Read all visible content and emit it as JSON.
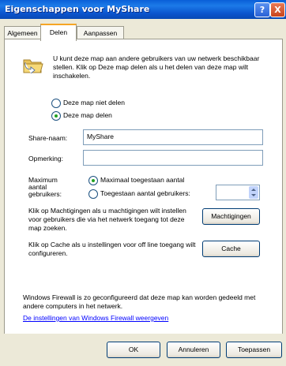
{
  "window": {
    "title": "Eigenschappen voor MyShare",
    "help_glyph": "?",
    "close_glyph": "X"
  },
  "tabs": [
    {
      "label": "Algemeen"
    },
    {
      "label": "Delen"
    },
    {
      "label": "Aanpassen"
    }
  ],
  "intro_text": "U kunt deze map aan andere gebruikers van uw netwerk beschikbaar stellen. Klik op Deze map delen als u het delen van deze map wilt inschakelen.",
  "share_options": {
    "not_share": "Deze map niet delen",
    "share": "Deze map delen"
  },
  "form": {
    "share_name_label": "Share-naam:",
    "share_name_value": "MyShare",
    "comment_label": "Opmerking:",
    "comment_value": "",
    "max_users_label_1": "Maximum",
    "max_users_label_2": "aantal",
    "max_users_label_3": "gebruikers:",
    "max_allowed": "Maximaal toegestaan aantal",
    "allowed_users": "Toegestaan aantal gebruikers:",
    "allowed_users_value": ""
  },
  "permissions": {
    "text": "Klik op Machtigingen als u machtigingen wilt instellen voor gebruikers die via het netwerk toegang tot deze map zoeken.",
    "button": "Machtigingen"
  },
  "cache": {
    "text": "Klik op Cache als u instellingen voor off line toegang wilt configureren.",
    "button": "Cache"
  },
  "firewall": {
    "text": "Windows Firewall is zo geconfigureerd dat deze map kan worden gedeeld met andere computers in het netwerk.",
    "link": "De instellingen van Windows Firewall weergeven"
  },
  "footer": {
    "ok": "OK",
    "cancel": "Annuleren",
    "apply": "Toepassen"
  },
  "colors": {
    "titlebar": "#0a5fd8",
    "dialog_bg": "#ece9d8",
    "link": "#0000ff",
    "tab_highlight": "#f6a525",
    "radio_dot": "#21a121"
  },
  "icons": {
    "folder": "shared-folder-icon"
  }
}
